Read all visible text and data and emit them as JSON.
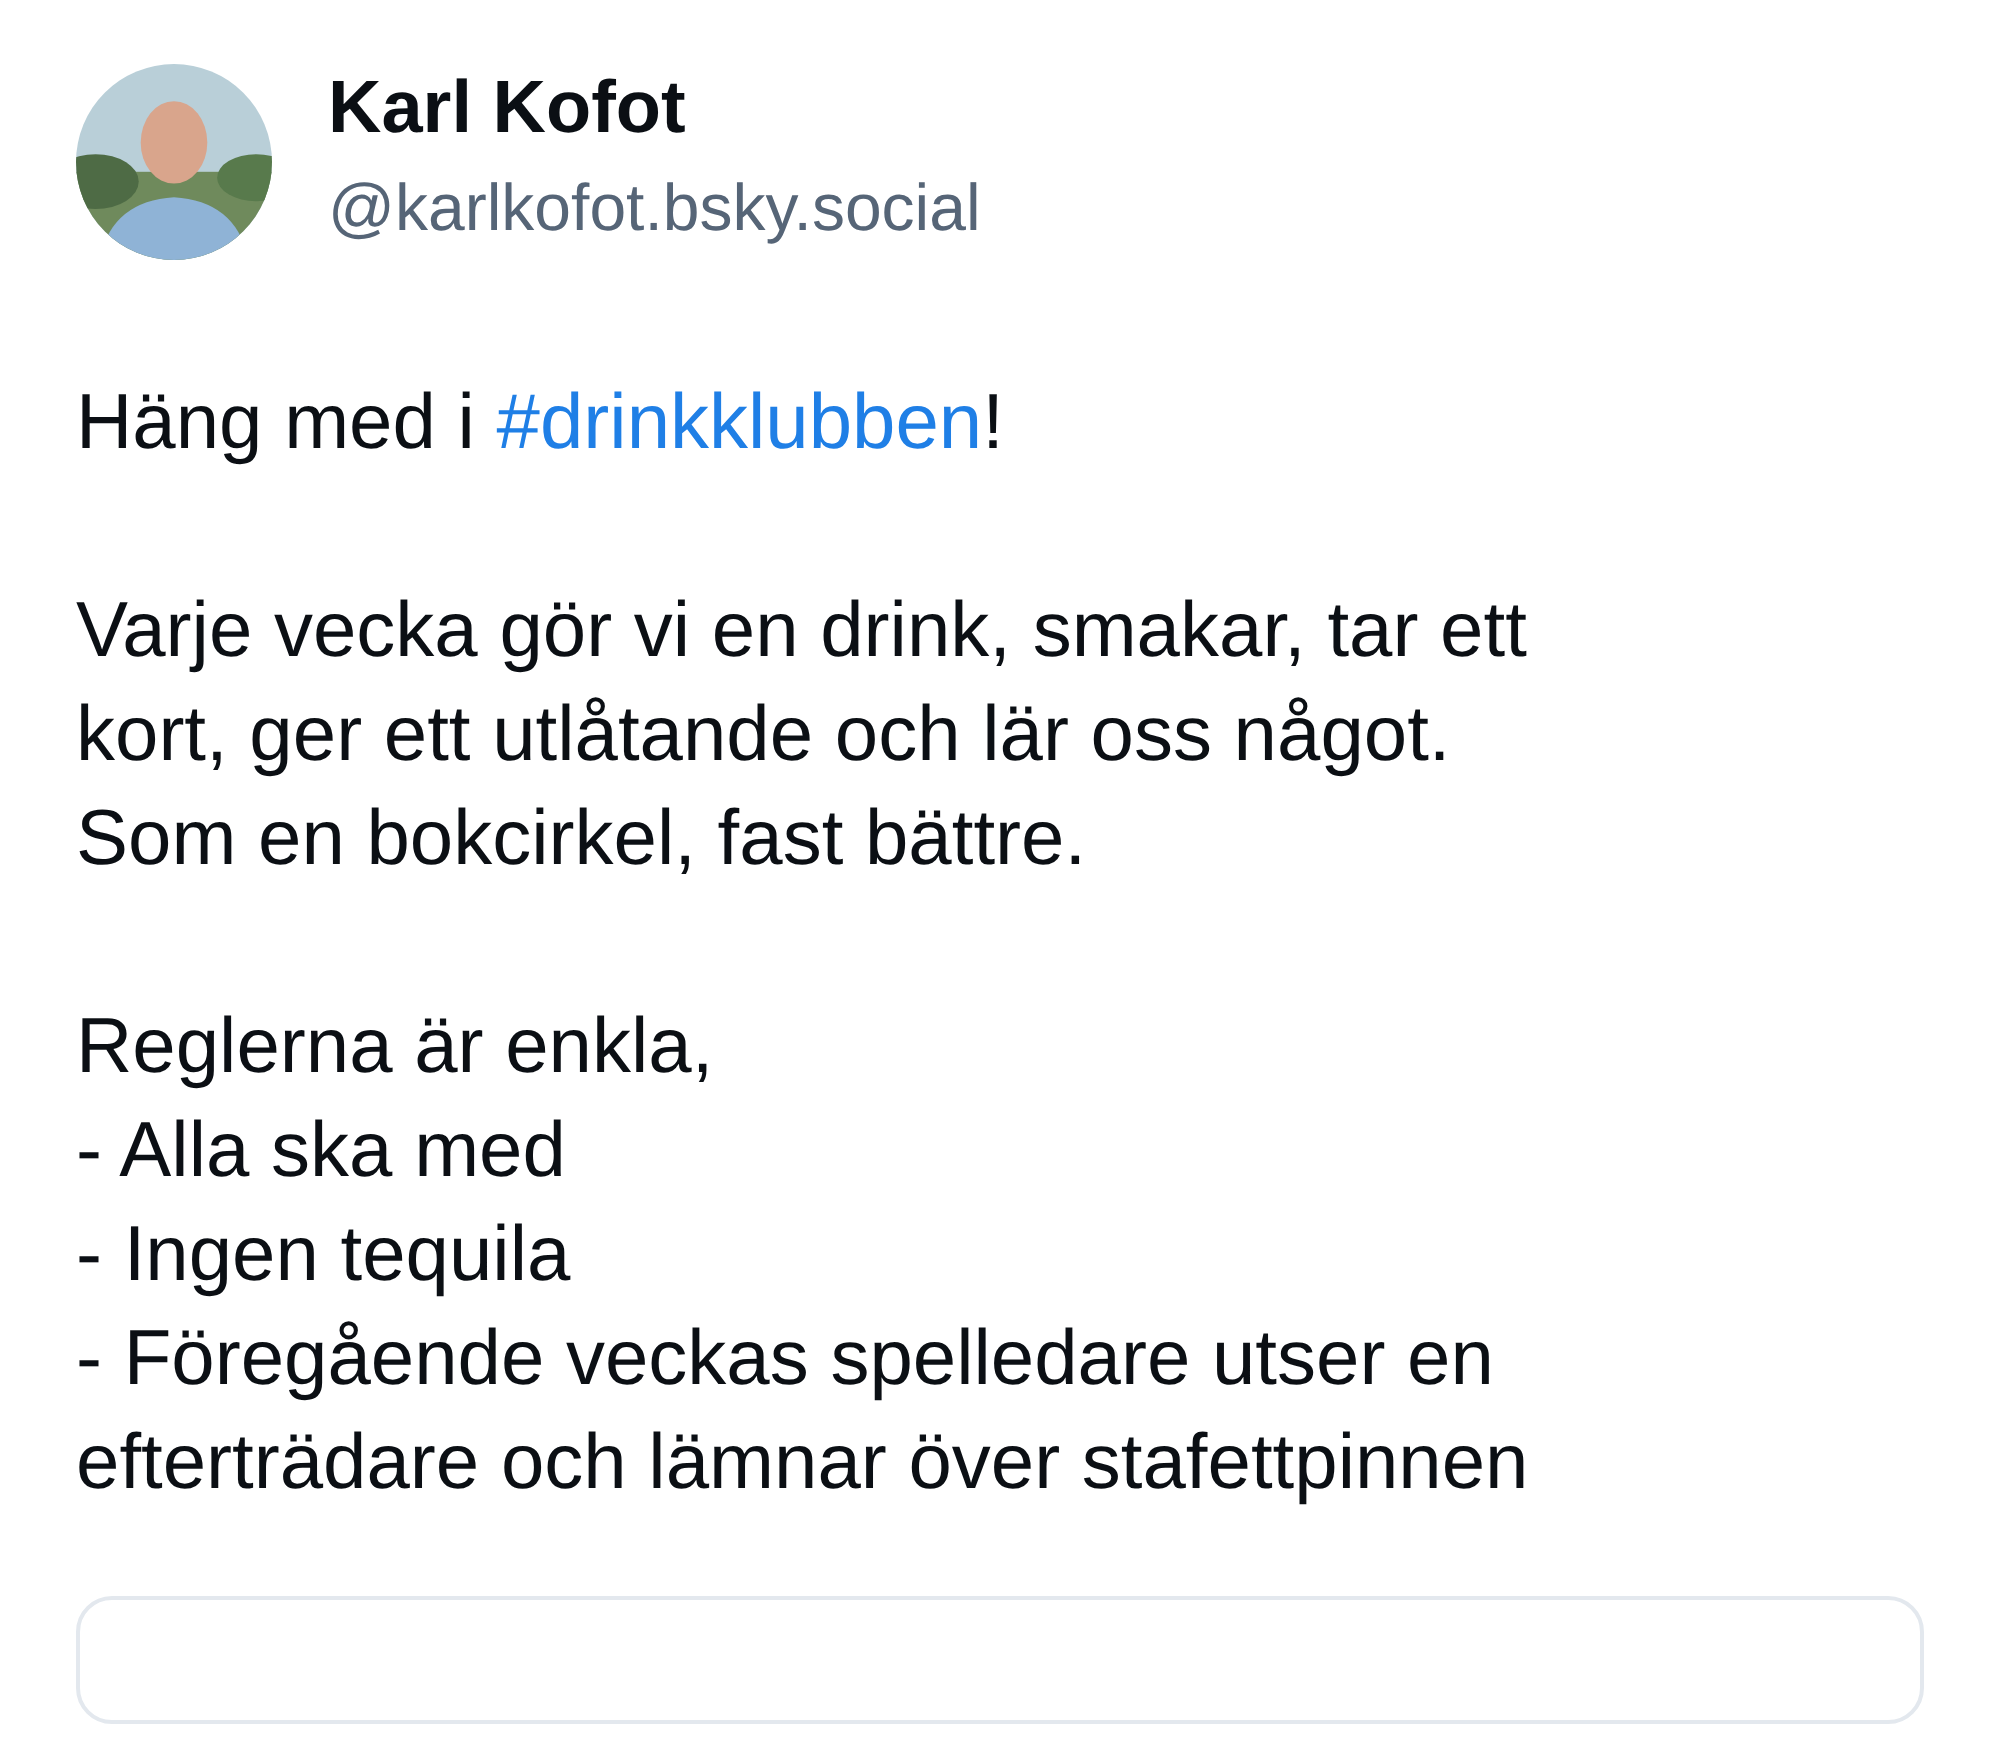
{
  "author": {
    "name": "Karl Kofot",
    "handle": "@karlkofot.bsky.social"
  },
  "intro": {
    "before": "Häng med i ",
    "hashtag": "#drinkklubben",
    "after": "!"
  },
  "paragraphs": [
    [
      "Varje vecka gör vi en drink, smakar, tar ett",
      "kort, ger ett utlåtande och lär oss något.",
      "Som en bokcirkel, fast bättre."
    ],
    [
      "Reglerna är enkla,",
      "- Alla ska med",
      "- Ingen tequila",
      "- Föregående veckas spelledare utser en",
      "efterträdare och lämnar över stafettpinnen"
    ]
  ]
}
